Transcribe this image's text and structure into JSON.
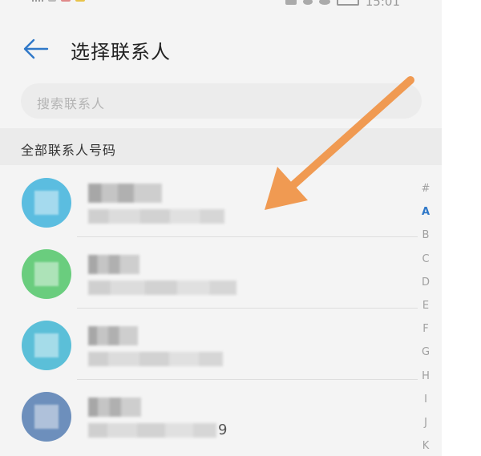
{
  "header": {
    "title": "选择联系人"
  },
  "search": {
    "placeholder": "搜索联系人"
  },
  "section": {
    "label": "全部联系人号码"
  },
  "status_bar": {
    "time": "15:01"
  },
  "contacts": [
    {
      "avatar_color": "#5bbde0",
      "name": "",
      "number": "",
      "visible_tail": ""
    },
    {
      "avatar_color": "#6acd7e",
      "name": "",
      "number": "",
      "visible_tail": ""
    },
    {
      "avatar_color": "#5bbfd8",
      "name": "",
      "number": "",
      "visible_tail": ""
    },
    {
      "avatar_color": "#6d8fbc",
      "name": "",
      "number": "",
      "visible_tail": "9"
    }
  ],
  "alphabet_index": {
    "letters": [
      "#",
      "A",
      "B",
      "C",
      "D",
      "E",
      "F",
      "G",
      "H",
      "I",
      "J",
      "K"
    ],
    "active": "A"
  },
  "colors": {
    "accent": "#2f78c8",
    "annotation_arrow": "#f09a52"
  }
}
